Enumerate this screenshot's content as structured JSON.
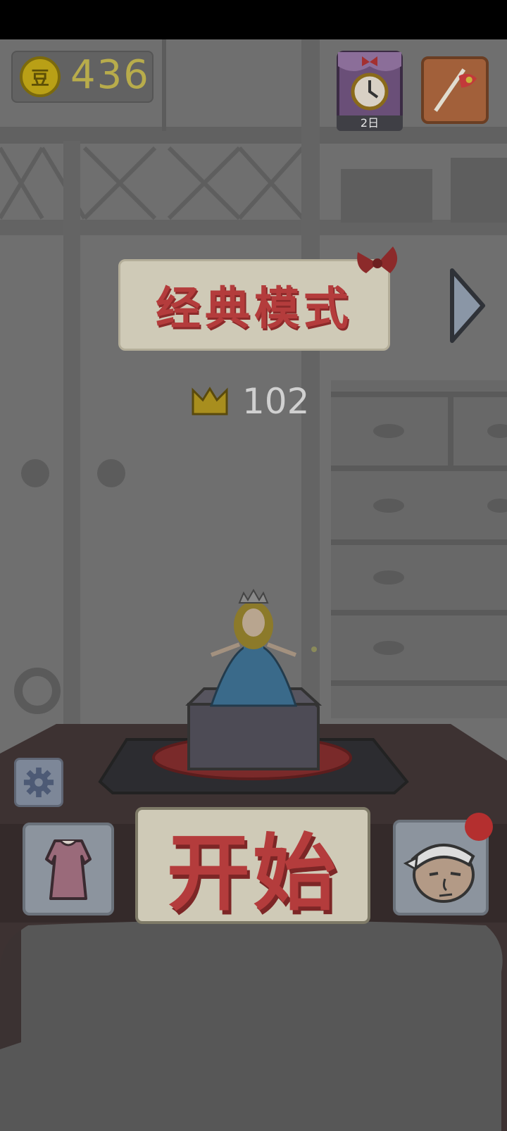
{
  "hud": {
    "coin_symbol": "豆",
    "coin_count": "436",
    "timer_label": "2日"
  },
  "mode": {
    "title": "经典模式",
    "crown_count": "102"
  },
  "actions": {
    "start_label": "开始"
  },
  "colors": {
    "accent_red": "#b43c3c",
    "plate": "#cfcab7",
    "coin_gold": "#b8ac4b",
    "dim_overlay": "#6f6f6f"
  },
  "icons": [
    "coin-icon",
    "timer-icon",
    "flag-icon",
    "right-arrow-icon",
    "crown-icon",
    "circle-icon",
    "gear-icon",
    "dress-icon",
    "boss-face-icon"
  ]
}
